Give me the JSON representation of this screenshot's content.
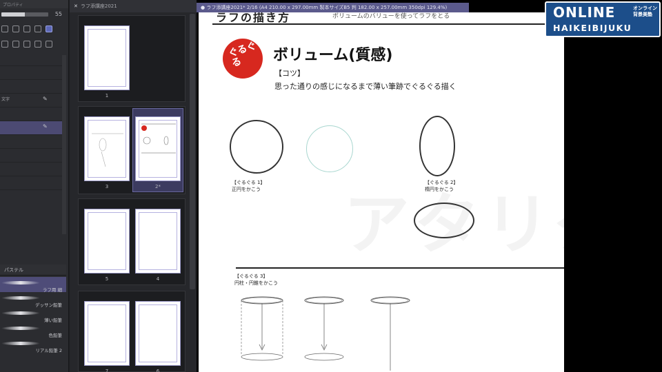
{
  "left_panel": {
    "title": "プロパティ",
    "slider_value": "55",
    "layers": [
      "",
      "",
      "",
      "文字",
      "",
      "",
      "",
      "",
      "",
      ""
    ],
    "brush_header": "パステル",
    "brushes": [
      {
        "label": "ラフ用 細",
        "selected": true
      },
      {
        "label": "デッサン鉛筆",
        "selected": false
      },
      {
        "label": "薄い鉛筆",
        "selected": false
      },
      {
        "label": "色鉛筆",
        "selected": false
      },
      {
        "label": "リアル鉛筆 2",
        "selected": false
      }
    ]
  },
  "pages_panel": {
    "tab_label": "ラフ添講座2021",
    "spreads": [
      {
        "labels": [
          "1"
        ]
      },
      {
        "labels": [
          "3",
          "2*"
        ]
      },
      {
        "labels": [
          "5",
          "4"
        ]
      },
      {
        "labels": [
          "7",
          "6"
        ]
      }
    ]
  },
  "canvas": {
    "doc_tab": "ラフ添講座2021* 2/16 (A4 210.00 x 297.00mm 製本サイズB5 判 182.00 x 257.00mm 350dpi 129.4%)",
    "header_title": "ラフの描き方",
    "header_subtitle": "ボリュームのバリューを使ってラフをとる",
    "logo_text": "ぐるぐる",
    "section_title": "ボリューム(質感)",
    "tip_label": "【コツ】",
    "tip_text": "思った通りの感じになるまで薄い筆跡でぐるぐる描く",
    "ghost_text": "アタリダ",
    "captions": {
      "c1_title": "【ぐるぐる 1】",
      "c1_sub": "正円をかこう",
      "c2_title": "【ぐるぐる 2】",
      "c2_sub": "楕円をかこう",
      "c3_title": "【ぐるぐる 3】",
      "c3_sub": "円柱・円錐をかこう"
    }
  },
  "brand": {
    "line1": "ONLINE",
    "line1_small_a": "オンライン",
    "line1_small_b": "背景美塾",
    "line2": "HAIKEIBIJUKU"
  }
}
